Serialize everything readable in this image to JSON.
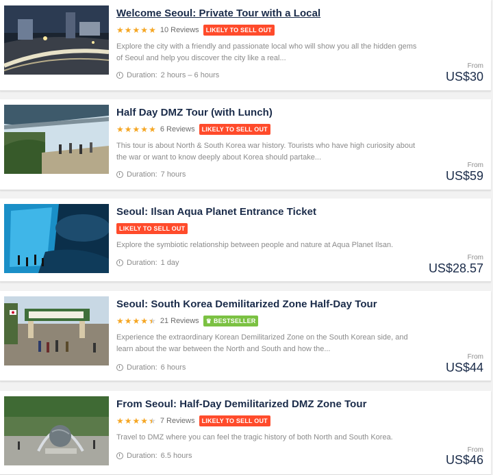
{
  "listings": [
    {
      "title": "Welcome Seoul: Private Tour with a Local",
      "stars": 5,
      "reviews": "10 Reviews",
      "badge": "LIKELY TO SELL OUT",
      "description": "Explore the city with a friendly and passionate local who will show you all the hidden gems of Seoul and help you discover the city like a real...",
      "duration_label": "Duration:",
      "duration": "2 hours – 6 hours",
      "from_label": "From",
      "price": "US$30"
    },
    {
      "title": "Half Day DMZ Tour (with Lunch)",
      "stars": 5,
      "reviews": "6 Reviews",
      "badge": "LIKELY TO SELL OUT",
      "description": "This tour is about North & South Korea war history. Tourists who have high curiosity about the war or want to know deeply about Korea should partake...",
      "duration_label": "Duration:",
      "duration": "7 hours",
      "from_label": "From",
      "price": "US$59"
    },
    {
      "title": "Seoul: Ilsan Aqua Planet Entrance Ticket",
      "badge": "LIKELY TO SELL OUT",
      "description": "Explore the symbiotic relationship between people and nature at Aqua Planet Ilsan.",
      "duration_label": "Duration:",
      "duration": "1 day",
      "from_label": "From",
      "price": "US$28.57"
    },
    {
      "title": "Seoul: South Korea Demilitarized Zone Half-Day Tour",
      "stars": 4.5,
      "reviews": "21 Reviews",
      "badge": "BESTSELLER",
      "description": "Experience the extraordinary Korean Demilitarized Zone on the South Korean side, and learn about the war between the North and South and how the...",
      "duration_label": "Duration:",
      "duration": "6 hours",
      "from_label": "From",
      "price": "US$44"
    },
    {
      "title": "From Seoul: Half-Day Demilitarized DMZ Zone Tour",
      "stars": 4.5,
      "reviews": "7 Reviews",
      "badge": "LIKELY TO SELL OUT",
      "description": "Travel to DMZ where you can feel the tragic history of both North and South Korea.",
      "duration_label": "Duration:",
      "duration": "6.5 hours",
      "from_label": "From",
      "price": "US$46"
    }
  ],
  "colors": {
    "title": "#1a2b49",
    "star": "#f5a623",
    "sell_out_badge": "#ff4b2b",
    "bestseller_badge": "#7bc142"
  },
  "icons": [
    "star-icon",
    "clock-icon",
    "crown-icon"
  ]
}
